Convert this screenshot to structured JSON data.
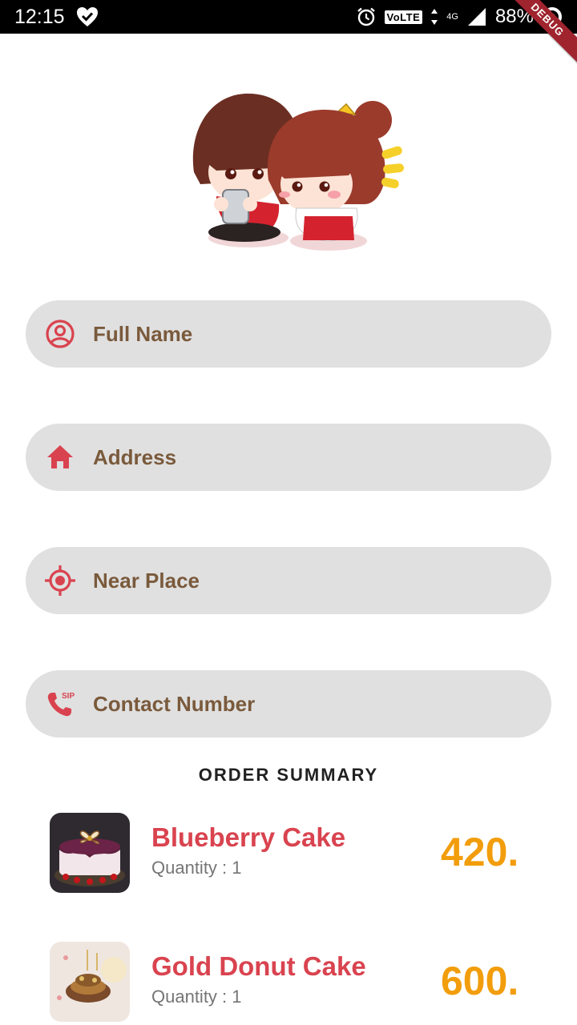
{
  "status_bar": {
    "time": "12:15",
    "volte": "VoLTE",
    "network": "4G",
    "battery": "88%"
  },
  "debug_banner": "DEBUG",
  "form": {
    "full_name": {
      "placeholder": "Full Name",
      "icon": "person-circle-icon"
    },
    "address": {
      "placeholder": "Address",
      "icon": "home-icon"
    },
    "near_place": {
      "placeholder": "Near Place",
      "icon": "location-target-icon"
    },
    "contact_number": {
      "placeholder": "Contact Number",
      "icon": "sip-phone-icon"
    }
  },
  "order_summary": {
    "title": "ORDER SUMMARY",
    "items": [
      {
        "name": "Blueberry Cake",
        "quantity": "Quantity : 1",
        "price": "420."
      },
      {
        "name": "Gold Donut Cake",
        "quantity": "Quantity : 1",
        "price": "600."
      }
    ]
  },
  "colors": {
    "accent": "#d9434f",
    "label": "#7a5a3c",
    "price": "#f29d0c",
    "field_bg": "#e0e0e0"
  }
}
